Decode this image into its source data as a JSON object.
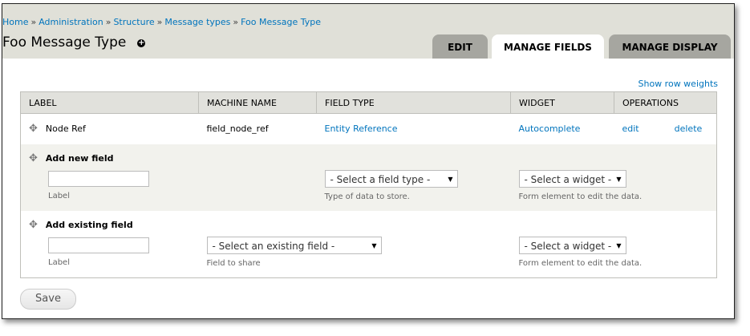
{
  "breadcrumb": [
    "Home",
    "Administration",
    "Structure",
    "Message types",
    "Foo Message Type"
  ],
  "breadcrumb_sep": "»",
  "page_title": "Foo Message Type",
  "tabs": [
    {
      "label": "EDIT"
    },
    {
      "label": "MANAGE FIELDS"
    },
    {
      "label": "MANAGE DISPLAY"
    }
  ],
  "show_row_weights": "Show row weights",
  "columns": [
    "LABEL",
    "MACHINE NAME",
    "FIELD TYPE",
    "WIDGET",
    "OPERATIONS"
  ],
  "row": {
    "label": "Node Ref",
    "machine": "field_node_ref",
    "type": "Entity Reference",
    "widget": "Autocomplete",
    "edit": "edit",
    "delete": "delete"
  },
  "add_new": {
    "title": "Add new field",
    "label_desc": "Label",
    "type_select": "- Select a field type -",
    "type_desc": "Type of data to store.",
    "widget_select": "- Select a widget -",
    "widget_desc": "Form element to edit the data."
  },
  "add_existing": {
    "title": "Add existing field",
    "label_desc": "Label",
    "field_select": "- Select an existing field -",
    "field_desc": "Field to share",
    "widget_select": "- Select a widget -",
    "widget_desc": "Form element to edit the data."
  },
  "save": "Save"
}
